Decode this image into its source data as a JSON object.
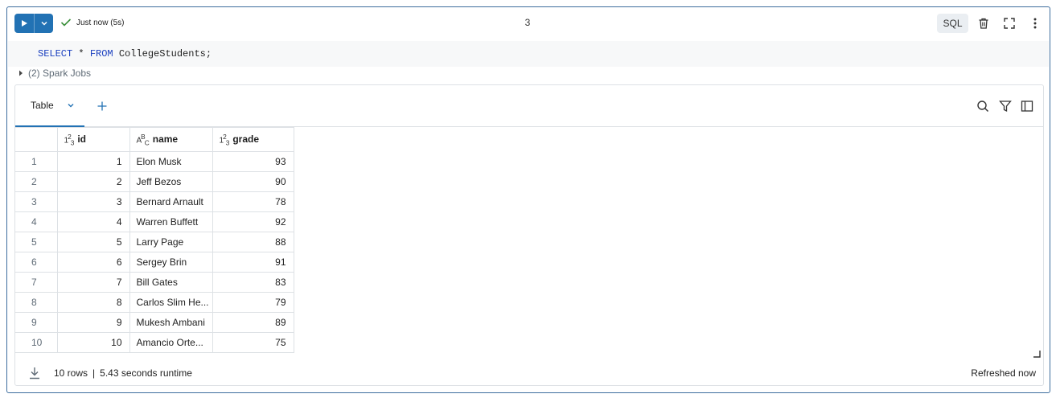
{
  "cell": {
    "status_text": "Just now (5s)",
    "cell_number": "3",
    "language": "SQL",
    "accent_color": "#2272b4",
    "status_color": "#3a8f3a"
  },
  "code": {
    "kw_select": "SELECT",
    "star": " * ",
    "kw_from": "FROM",
    "rest": " CollegeStudents;"
  },
  "spark_jobs": {
    "label": "(2) Spark Jobs"
  },
  "results": {
    "tab_label": "Table",
    "columns": [
      {
        "type_icon": "1²₃",
        "label": "id"
      },
      {
        "type_icon": "A^B_C",
        "label": "name"
      },
      {
        "type_icon": "1²₃",
        "label": "grade"
      }
    ],
    "rows": [
      {
        "idx": "1",
        "id": "1",
        "name": "Elon Musk",
        "grade": "93"
      },
      {
        "idx": "2",
        "id": "2",
        "name": "Jeff Bezos",
        "grade": "90"
      },
      {
        "idx": "3",
        "id": "3",
        "name": "Bernard Arnault",
        "grade": "78"
      },
      {
        "idx": "4",
        "id": "4",
        "name": "Warren Buffett",
        "grade": "92"
      },
      {
        "idx": "5",
        "id": "5",
        "name": "Larry Page",
        "grade": "88"
      },
      {
        "idx": "6",
        "id": "6",
        "name": "Sergey Brin",
        "grade": "91"
      },
      {
        "idx": "7",
        "id": "7",
        "name": "Bill Gates",
        "grade": "83"
      },
      {
        "idx": "8",
        "id": "8",
        "name": "Carlos Slim He...",
        "grade": "79"
      },
      {
        "idx": "9",
        "id": "9",
        "name": "Mukesh Ambani",
        "grade": "89"
      },
      {
        "idx": "10",
        "id": "10",
        "name": "Amancio Orte...",
        "grade": "75"
      }
    ]
  },
  "footer": {
    "rows_text": "10 rows",
    "separator": "|",
    "runtime_text": "5.43 seconds runtime",
    "refreshed_text": "Refreshed now"
  }
}
